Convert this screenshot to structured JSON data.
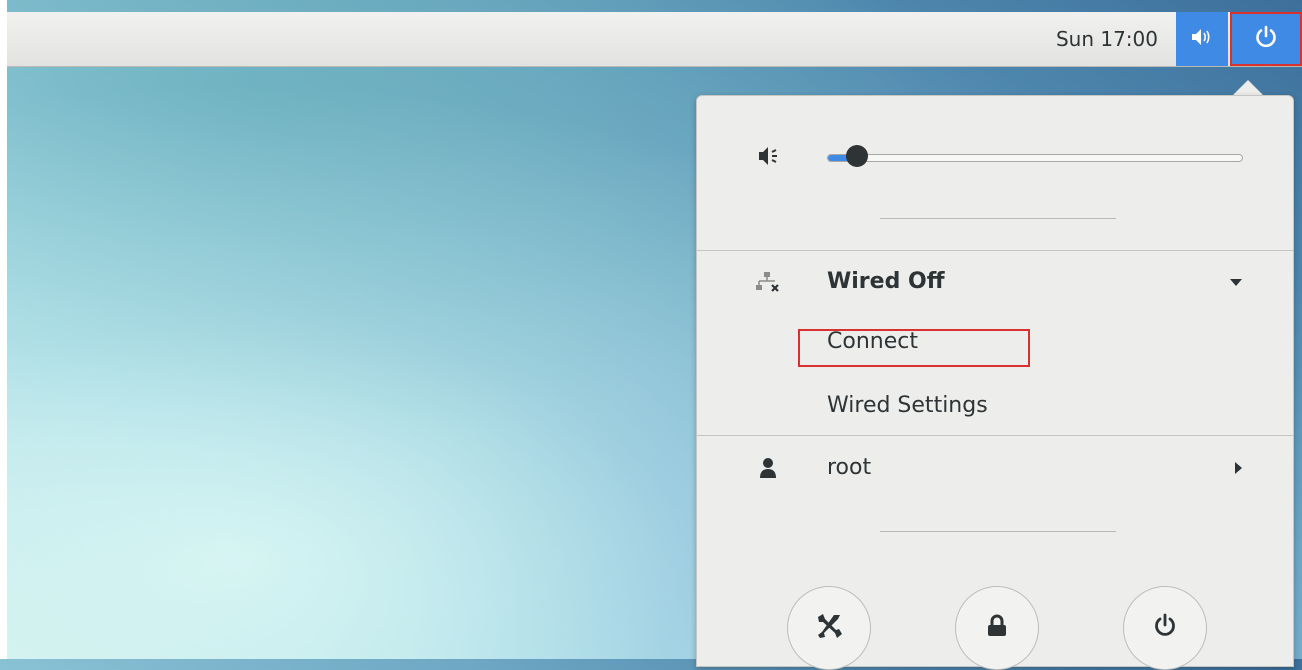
{
  "topbar": {
    "clock": "Sun 17:00",
    "volume_icon": "volume-high-icon",
    "power_icon": "power-icon",
    "accent": "#3f8ae4"
  },
  "panel": {
    "volume": {
      "icon": "audio-volume-low-icon",
      "level": 0.07
    },
    "network": {
      "icon": "wired-disconnected-icon",
      "title": "Wired Off",
      "items": [
        "Connect",
        "Wired Settings"
      ]
    },
    "user": {
      "icon": "user-icon",
      "name": "root"
    },
    "actions": [
      {
        "name": "settings-button",
        "icon": "settings-tools-icon"
      },
      {
        "name": "lock-button",
        "icon": "lock-icon"
      },
      {
        "name": "power-off-button",
        "icon": "power-icon"
      }
    ]
  },
  "highlight_color": "#d93030"
}
